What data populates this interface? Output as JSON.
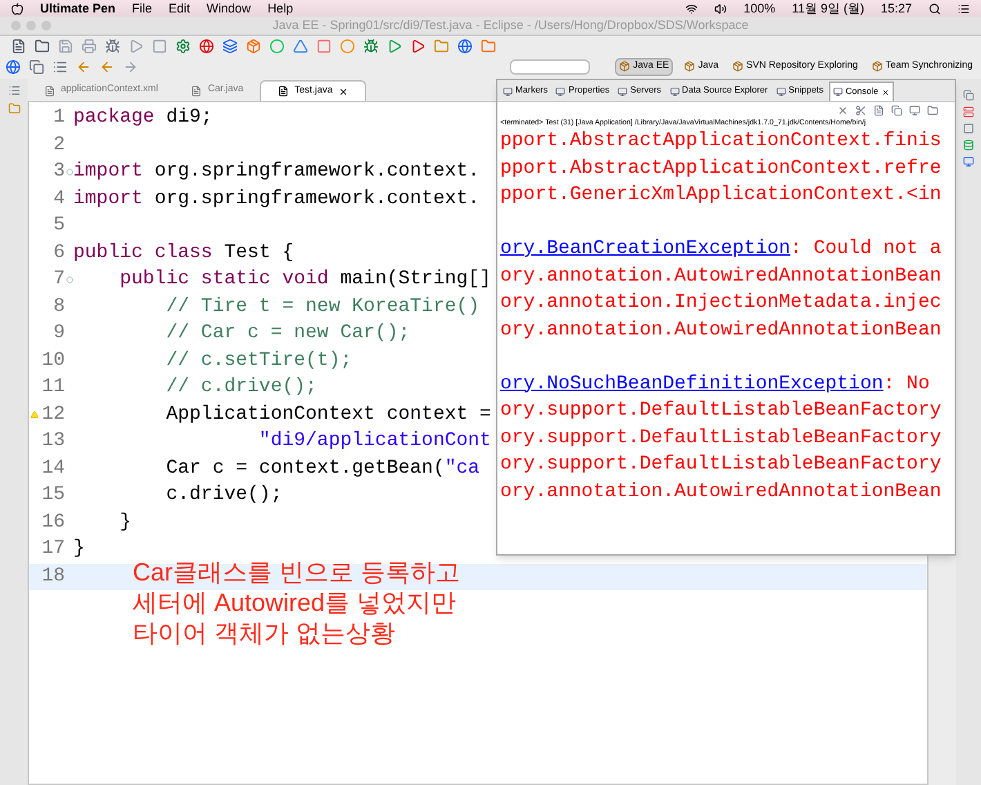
{
  "menu_bar": {
    "app_name": "Ultimate Pen",
    "items": [
      "File",
      "Edit",
      "Window",
      "Help"
    ],
    "battery": "100%",
    "date": "11월 9일 (월)",
    "time": "15:27"
  },
  "window": {
    "title": "Java EE - Spring01/src/di9/Test.java - Eclipse - /Users/Hong/Dropbox/SDS/Workspace"
  },
  "perspectives": [
    {
      "label": "Java EE",
      "selected": true
    },
    {
      "label": "Java",
      "selected": false
    },
    {
      "label": "SVN Repository Exploring",
      "selected": false
    },
    {
      "label": "Team Synchronizing",
      "selected": false
    }
  ],
  "editor_tabs": [
    {
      "label": "applicationContext.xml",
      "selected": false
    },
    {
      "label": "Car.java",
      "selected": false
    },
    {
      "label": "Test.java",
      "selected": true
    }
  ],
  "editor_lines": [
    {
      "number": "1",
      "parts": [
        {
          "kind": "keyword",
          "text": "package"
        },
        {
          "kind": "plain",
          "text": " di9;"
        }
      ]
    },
    {
      "number": "2"
    },
    {
      "number": "3",
      "fold": true,
      "parts": [
        {
          "kind": "keyword",
          "text": "import"
        },
        {
          "kind": "plain",
          "text": " org.springframework.context."
        }
      ]
    },
    {
      "number": "4",
      "parts": [
        {
          "kind": "keyword",
          "text": "import"
        },
        {
          "kind": "plain",
          "text": " org.springframework.context."
        }
      ]
    },
    {
      "number": "5"
    },
    {
      "number": "6",
      "parts": [
        {
          "kind": "keyword",
          "text": "public"
        },
        {
          "kind": "keyword",
          "text": " class"
        },
        {
          "kind": "plain",
          "text": " Test {"
        }
      ]
    },
    {
      "number": "7",
      "fold": true,
      "parts": [
        {
          "kind": "keyword",
          "text": "    public"
        },
        {
          "kind": "keyword",
          "text": " static"
        },
        {
          "kind": "keyword",
          "text": " void"
        },
        {
          "kind": "plain",
          "text": " main(String[]"
        }
      ]
    },
    {
      "number": "8",
      "parts": [
        {
          "kind": "comment",
          "text": "        // Tire t = new KoreaTire()"
        }
      ]
    },
    {
      "number": "9",
      "parts": [
        {
          "kind": "comment",
          "text": "        // Car c = new Car();"
        }
      ]
    },
    {
      "number": "10",
      "parts": [
        {
          "kind": "comment",
          "text": "        // c.setTire(t);"
        }
      ]
    },
    {
      "number": "11",
      "parts": [
        {
          "kind": "comment",
          "text": "        // c.drive();"
        }
      ]
    },
    {
      "number": "12",
      "warning": true,
      "parts": [
        {
          "kind": "plain",
          "text": "        ApplicationContext context ="
        }
      ]
    },
    {
      "number": "13",
      "parts": [
        {
          "kind": "string",
          "text": "                \"di9/applicationCont"
        }
      ]
    },
    {
      "number": "14",
      "parts": [
        {
          "kind": "plain",
          "text": "        Car c = context.getBean("
        },
        {
          "kind": "string",
          "text": "\"ca"
        }
      ]
    },
    {
      "number": "15",
      "parts": [
        {
          "kind": "plain",
          "text": "        c.drive();"
        }
      ]
    },
    {
      "number": "16",
      "parts": [
        {
          "kind": "plain",
          "text": "    }"
        }
      ]
    },
    {
      "number": "17",
      "parts": [
        {
          "kind": "plain",
          "text": "}"
        }
      ]
    },
    {
      "number": "18",
      "current": true
    }
  ],
  "annotation": [
    "Car클래스를 빈으로 등록하고",
    "세터에 Autowired를 넣었지만",
    "타이어 객체가 없는상황"
  ],
  "view_tabs": [
    {
      "label": "Markers",
      "selected": false
    },
    {
      "label": "Properties",
      "selected": false
    },
    {
      "label": "Servers",
      "selected": false
    },
    {
      "label": "Data Source Explorer",
      "selected": false
    },
    {
      "label": "Snippets",
      "selected": false
    },
    {
      "label": "Console",
      "selected": true
    }
  ],
  "console": {
    "header": "<terminated> Test (31) [Java Application] /Library/Java/JavaVirtualMachines/jdk1.7.0_71.jdk/Contents/Home/bin/j",
    "blocks": [
      [
        {
          "parts": [
            {
              "kind": "error",
              "text": "pport.AbstractApplicationContext.finis"
            }
          ]
        },
        {
          "parts": [
            {
              "kind": "error",
              "text": "pport.AbstractApplicationContext.refre"
            }
          ]
        },
        {
          "parts": [
            {
              "kind": "error",
              "text": "pport.GenericXmlApplicationContext.<in"
            }
          ]
        }
      ],
      [
        {
          "parts": [
            {
              "kind": "link",
              "text": "ory.BeanCreationException"
            },
            {
              "kind": "error",
              "text": ": Could not a"
            }
          ]
        },
        {
          "parts": [
            {
              "kind": "error",
              "text": "ory.annotation.AutowiredAnnotationBean"
            }
          ]
        },
        {
          "parts": [
            {
              "kind": "error",
              "text": "ory.annotation.InjectionMetadata.injec"
            }
          ]
        },
        {
          "parts": [
            {
              "kind": "error",
              "text": "ory.annotation.AutowiredAnnotationBean"
            }
          ]
        }
      ],
      [
        {
          "parts": [
            {
              "kind": "link",
              "text": "ory.NoSuchBeanDefinitionException"
            },
            {
              "kind": "error",
              "text": ": No"
            }
          ]
        },
        {
          "parts": [
            {
              "kind": "error",
              "text": "ory.support.DefaultListableBeanFactory"
            }
          ]
        },
        {
          "parts": [
            {
              "kind": "error",
              "text": "ory.support.DefaultListableBeanFactory"
            }
          ]
        },
        {
          "parts": [
            {
              "kind": "error",
              "text": "ory.support.DefaultListableBeanFactory"
            }
          ]
        },
        {
          "parts": [
            {
              "kind": "error",
              "text": "ory.annotation.AutowiredAnnotationBean"
            }
          ]
        }
      ]
    ]
  }
}
